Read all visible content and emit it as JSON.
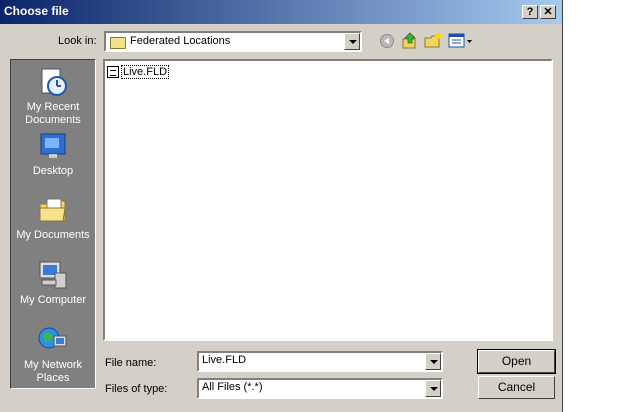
{
  "window": {
    "title": "Choose file"
  },
  "title_buttons": {
    "help": "?",
    "close": "✕"
  },
  "toolbar": {
    "look_in_label": "Look in:",
    "look_in_value": "Federated Locations",
    "icons": [
      "back-icon",
      "up-folder-icon",
      "new-folder-icon",
      "views-menu-icon"
    ]
  },
  "places": [
    {
      "label": "My Recent Documents",
      "icon": "recent-documents-icon"
    },
    {
      "label": "Desktop",
      "icon": "desktop-icon"
    },
    {
      "label": "My Documents",
      "icon": "my-documents-icon"
    },
    {
      "label": "My Computer",
      "icon": "my-computer-icon"
    },
    {
      "label": "My Network Places",
      "icon": "network-places-icon"
    }
  ],
  "files": [
    {
      "name": "Live.FLD",
      "icon": "fld-file-icon"
    }
  ],
  "form": {
    "file_name_label": "File name:",
    "file_name_value": "Live.FLD",
    "file_type_label": "Files of type:",
    "file_type_value": "All Files (*.*)"
  },
  "buttons": {
    "open": "Open",
    "cancel": "Cancel"
  }
}
